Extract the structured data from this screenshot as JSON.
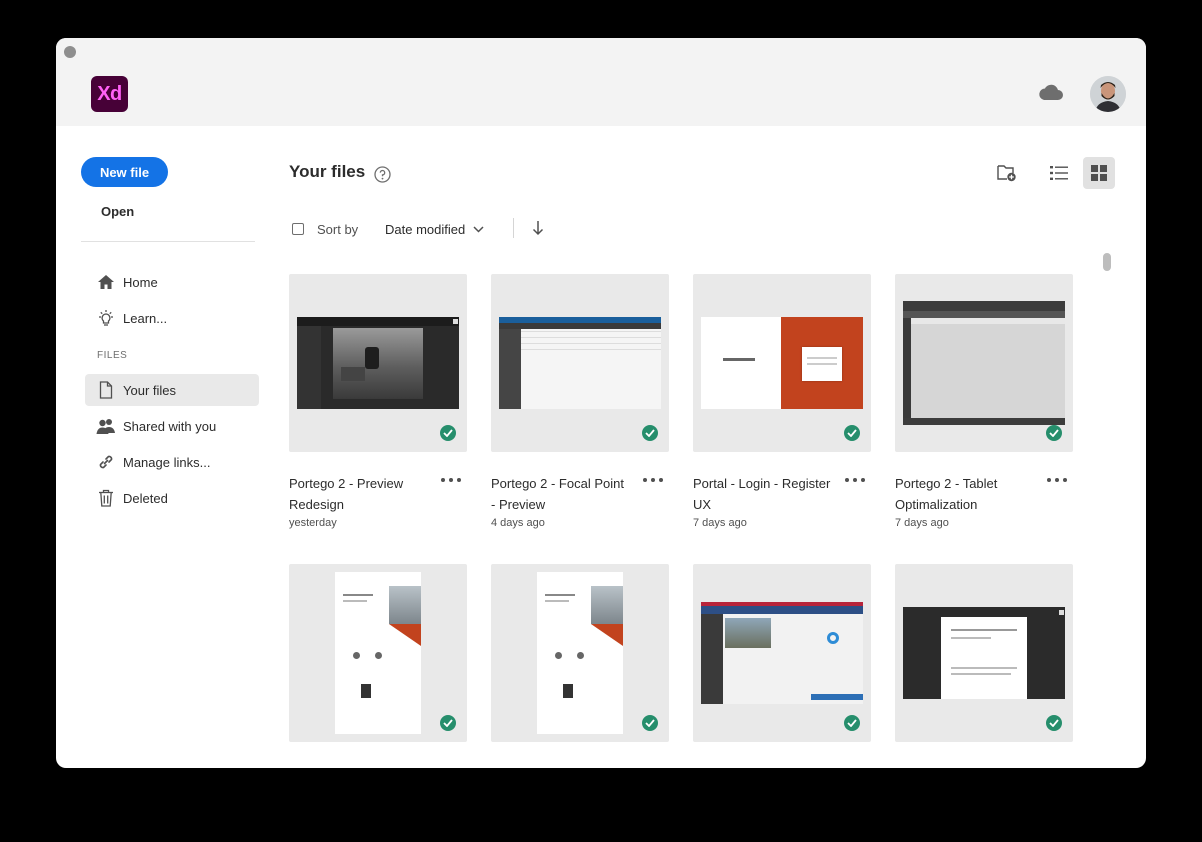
{
  "app": {
    "logo_text": "Xd"
  },
  "header": {
    "cloud_icon": "cloud-icon",
    "avatar": "user-avatar"
  },
  "sidebar": {
    "new_file_label": "New file",
    "open_label": "Open",
    "nav": [
      {
        "label": "Home",
        "icon": "home-icon"
      },
      {
        "label": "Learn...",
        "icon": "lightbulb-icon"
      }
    ],
    "files_heading": "FILES",
    "files_nav": [
      {
        "label": "Your files",
        "icon": "document-icon",
        "active": true
      },
      {
        "label": "Shared with you",
        "icon": "people-icon"
      },
      {
        "label": "Manage links...",
        "icon": "link-icon"
      },
      {
        "label": "Deleted",
        "icon": "trash-icon"
      }
    ]
  },
  "main": {
    "title": "Your files",
    "sort_label": "Sort by",
    "sort_value": "Date modified",
    "view_mode": "grid",
    "files": [
      {
        "name": "Portego 2 - Preview Redesign",
        "date": "yesterday",
        "synced": true
      },
      {
        "name": "Portego 2 - Focal Point - Preview",
        "date": "4 days ago",
        "synced": true
      },
      {
        "name": "Portal - Login - Register UX",
        "date": "7 days ago",
        "synced": true
      },
      {
        "name": "Portego 2 - Tablet Optimalization",
        "date": "7 days ago",
        "synced": true
      },
      {
        "name": "",
        "date": "",
        "synced": true
      },
      {
        "name": "",
        "date": "",
        "synced": true
      },
      {
        "name": "",
        "date": "",
        "synced": true
      },
      {
        "name": "",
        "date": "",
        "synced": true
      }
    ]
  },
  "colors": {
    "accent": "#1473e6",
    "sync_ok": "#268e6c",
    "xd_bg": "#470137",
    "xd_fg": "#ff61f6"
  }
}
